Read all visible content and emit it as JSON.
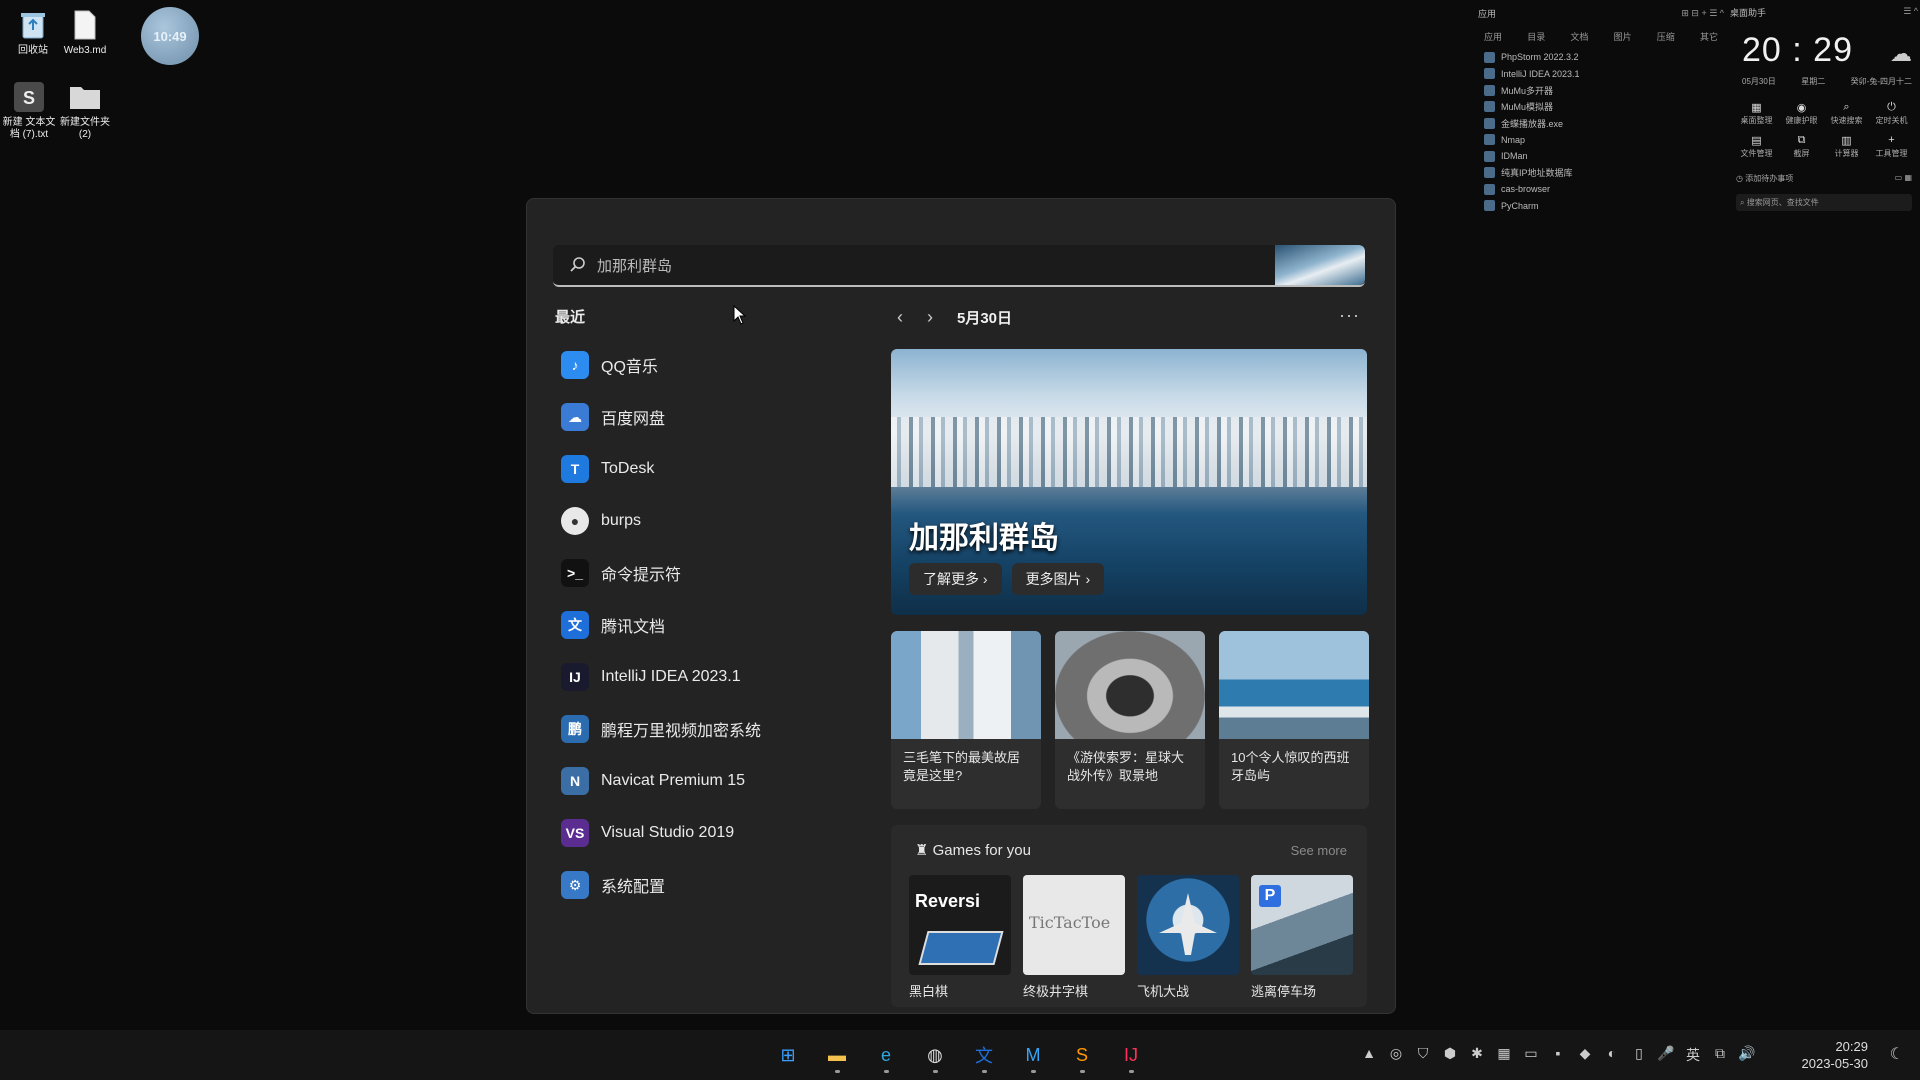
{
  "desktop": {
    "icons": [
      {
        "label": "回收站"
      },
      {
        "label": "Web3.md"
      },
      {
        "label": "新建 文本文档 (7).txt"
      },
      {
        "label": "新建文件夹 (2)"
      }
    ],
    "clock_bubble": "10:49"
  },
  "applist": {
    "header": "应用",
    "tabs": [
      "应用",
      "目录",
      "文档",
      "图片",
      "压缩",
      "其它"
    ],
    "apps": [
      "PhpStorm 2022.3.2",
      "IntelliJ IDEA 2023.1",
      "MuMu多开器",
      "MuMu模拟器",
      "金蝶播放器.exe",
      "Nmap",
      "IDMan",
      "纯真IP地址数据库",
      "cas-browser",
      "PyCharm"
    ]
  },
  "assistant": {
    "header": "桌面助手",
    "time": "20 : 29",
    "date": "05月30日",
    "weekday": "星期二",
    "lunar": "癸卯-兔-四月十二",
    "tools": [
      {
        "icon": "▦",
        "label": "桌面整理"
      },
      {
        "icon": "◉",
        "label": "健康护眼"
      },
      {
        "icon": "⌕",
        "label": "快速搜索"
      },
      {
        "icon": "⏻",
        "label": "定时关机"
      },
      {
        "icon": "▤",
        "label": "文件管理"
      },
      {
        "icon": "⧉",
        "label": "截屏"
      },
      {
        "icon": "▥",
        "label": "计算器"
      },
      {
        "icon": "+",
        "label": "工具管理"
      }
    ],
    "todo": "添加待办事项",
    "search_placeholder": "搜索网页、查找文件"
  },
  "panel": {
    "search_value": "加那利群岛",
    "recent_title": "最近",
    "recent": [
      {
        "label": "QQ音乐",
        "icon": "♪",
        "color": "#2d8cf0"
      },
      {
        "label": "百度网盘",
        "icon": "☁",
        "color": "#3a7bd5"
      },
      {
        "label": "ToDesk",
        "icon": "T",
        "color": "#1f7ae0"
      },
      {
        "label": "burps",
        "icon": "●",
        "color": "#e8e8e8"
      },
      {
        "label": "命令提示符",
        "icon": ">_",
        "color": "#111111"
      },
      {
        "label": "腾讯文档",
        "icon": "文",
        "color": "#1e6fd9"
      },
      {
        "label": "IntelliJ IDEA 2023.1",
        "icon": "IJ",
        "color": "#1a1a2e"
      },
      {
        "label": "鹏程万里视频加密系统",
        "icon": "鹏",
        "color": "#2b6cb0"
      },
      {
        "label": "Navicat Premium 15",
        "icon": "N",
        "color": "#3b6ea5"
      },
      {
        "label": "Visual Studio 2019",
        "icon": "VS",
        "color": "#5c2d91"
      },
      {
        "label": "系统配置",
        "icon": "⚙",
        "color": "#3778c7"
      }
    ],
    "nav_date": "5月30日",
    "more": "···",
    "hero": {
      "title": "加那利群岛",
      "learn_more": "了解更多 ›",
      "more_images": "更多图片 ›"
    },
    "cards": [
      {
        "caption": "三毛笔下的最美故居竟是这里?"
      },
      {
        "caption": "《游侠索罗：星球大战外传》取景地"
      },
      {
        "caption": "10个令人惊叹的西班牙岛屿"
      }
    ],
    "games": {
      "title": "Games for you",
      "see_more": "See more",
      "items": [
        {
          "name": "黑白棋",
          "art": "Reversi"
        },
        {
          "name": "终极井字棋",
          "art": "TicTacToe"
        },
        {
          "name": "飞机大战",
          "art": ""
        },
        {
          "name": "逃离停车场",
          "art": "P"
        }
      ]
    }
  },
  "taskbar": {
    "apps": [
      {
        "icon": "⊞",
        "name": "start",
        "color": "#3aa0ff"
      },
      {
        "icon": "▬",
        "name": "explorer",
        "color": "#f2c14e"
      },
      {
        "icon": "e",
        "name": "edge",
        "color": "#2fa6e0"
      },
      {
        "icon": "◍",
        "name": "chrome",
        "color": "#dddddd"
      },
      {
        "icon": "文",
        "name": "tencent-docs",
        "color": "#1e6fd9"
      },
      {
        "icon": "M",
        "name": "mumu",
        "color": "#36a3f7"
      },
      {
        "icon": "S",
        "name": "sublime",
        "color": "#ff9800"
      },
      {
        "icon": "IJ",
        "name": "intellij",
        "color": "#fe315d"
      }
    ],
    "tray": [
      "▲",
      "◎",
      "⛉",
      "⬢",
      "✱",
      "▦",
      "▭",
      "▪",
      "◆",
      "◐",
      "▯",
      "🎤",
      "英",
      "⧉",
      "🔊"
    ],
    "time": "20:29",
    "date": "2023-05-30",
    "moon": "☾"
  }
}
